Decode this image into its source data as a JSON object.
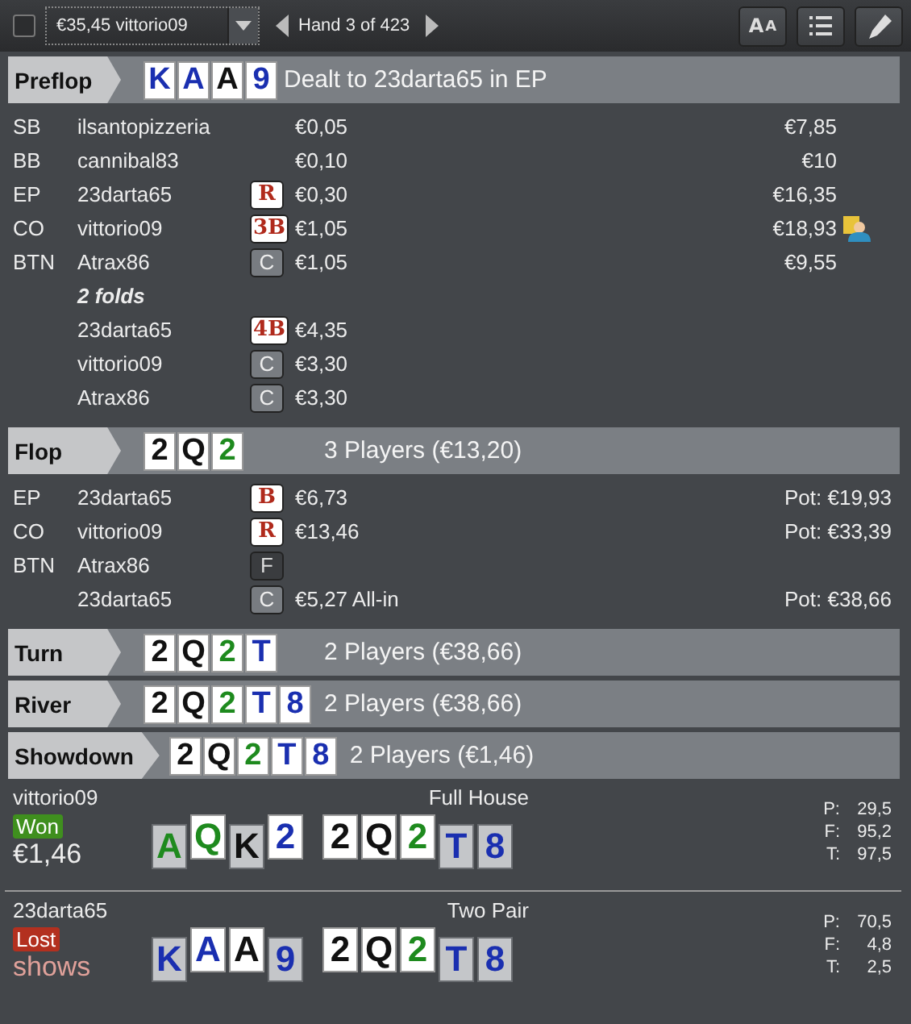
{
  "toolbar": {
    "checked": false,
    "player_select": "€35,45 vittorio09",
    "hand_label": "Hand 3 of 423",
    "font_button": "AA"
  },
  "streets": [
    {
      "kind": "preflop",
      "name": "Preflop",
      "summary": "Dealt to 23darta65 in EP",
      "cards": [
        {
          "rank": "K",
          "color": "#1a2fb0"
        },
        {
          "rank": "A",
          "color": "#1a2fb0"
        },
        {
          "rank": "A",
          "color": "#111111"
        },
        {
          "rank": "9",
          "color": "#1a2fb0"
        }
      ],
      "rows": [
        {
          "kind": "action",
          "position": "SB",
          "player": "ilsantopizzeria",
          "amount": "€0,05",
          "stack": "€7,85",
          "hero": false
        },
        {
          "kind": "action",
          "position": "BB",
          "player": "cannibal83",
          "amount": "€0,10",
          "stack": "€10",
          "hero": false
        },
        {
          "kind": "action",
          "position": "EP",
          "player": "23darta65",
          "badge": {
            "label": "R",
            "kind": "bet"
          },
          "amount": "€0,30",
          "stack": "€16,35",
          "hero": false
        },
        {
          "kind": "action",
          "position": "CO",
          "player": "vittorio09",
          "badge": {
            "label": "3B",
            "kind": "bet"
          },
          "amount": "€1,05",
          "stack": "€18,93",
          "hero": true
        },
        {
          "kind": "action",
          "position": "BTN",
          "player": "Atrax86",
          "badge": {
            "label": "C",
            "kind": "call"
          },
          "amount": "€1,05",
          "stack": "€9,55",
          "hero": false
        },
        {
          "kind": "note",
          "player": "2 folds"
        },
        {
          "kind": "action",
          "player": "23darta65",
          "badge": {
            "label": "4B",
            "kind": "bet"
          },
          "amount": "€4,35"
        },
        {
          "kind": "action",
          "player": "vittorio09",
          "badge": {
            "label": "C",
            "kind": "call"
          },
          "amount": "€3,30"
        },
        {
          "kind": "action",
          "player": "Atrax86",
          "badge": {
            "label": "C",
            "kind": "call"
          },
          "amount": "€3,30"
        }
      ]
    },
    {
      "kind": "street",
      "name": "Flop",
      "summary": "3 Players (€13,20)",
      "cards": [
        {
          "rank": "2",
          "color": "#111111"
        },
        {
          "rank": "Q",
          "color": "#111111"
        },
        {
          "rank": "2",
          "color": "#1e8a1e"
        }
      ],
      "rows": [
        {
          "kind": "action",
          "position": "EP",
          "player": "23darta65",
          "badge": {
            "label": "B",
            "kind": "bet"
          },
          "amount": "€6,73",
          "pot": "Pot: €19,93"
        },
        {
          "kind": "action",
          "position": "CO",
          "player": "vittorio09",
          "badge": {
            "label": "R",
            "kind": "bet"
          },
          "amount": "€13,46",
          "pot": "Pot: €33,39"
        },
        {
          "kind": "action",
          "position": "BTN",
          "player": "Atrax86",
          "badge": {
            "label": "F",
            "kind": "fold"
          }
        },
        {
          "kind": "action",
          "player": "23darta65",
          "badge": {
            "label": "C",
            "kind": "call"
          },
          "amount": "€5,27 All-in",
          "pot": "Pot: €38,66"
        }
      ]
    },
    {
      "kind": "street",
      "name": "Turn",
      "summary": "2 Players (€38,66)",
      "cards": [
        {
          "rank": "2",
          "color": "#111111"
        },
        {
          "rank": "Q",
          "color": "#111111"
        },
        {
          "rank": "2",
          "color": "#1e8a1e"
        },
        {
          "rank": "T",
          "color": "#1a2fb0"
        }
      ]
    },
    {
      "kind": "street",
      "name": "River",
      "summary": "2 Players (€38,66)",
      "cards": [
        {
          "rank": "2",
          "color": "#111111"
        },
        {
          "rank": "Q",
          "color": "#111111"
        },
        {
          "rank": "2",
          "color": "#1e8a1e"
        },
        {
          "rank": "T",
          "color": "#1a2fb0"
        },
        {
          "rank": "8",
          "color": "#1a2fb0"
        }
      ]
    },
    {
      "kind": "showdown",
      "name": "Showdown",
      "summary": "2 Players (€1,46)",
      "cards": [
        {
          "rank": "2",
          "color": "#111111"
        },
        {
          "rank": "Q",
          "color": "#111111"
        },
        {
          "rank": "2",
          "color": "#1e8a1e"
        },
        {
          "rank": "T",
          "color": "#1a2fb0"
        },
        {
          "rank": "8",
          "color": "#1a2fb0"
        }
      ]
    }
  ],
  "showdown": [
    {
      "player": "vittorio09",
      "hand": "Full House",
      "result": {
        "label": "Won",
        "kind": "won"
      },
      "amount": "€1,46",
      "hole_cards": [
        {
          "rank": "A",
          "color": "#1e8a1e",
          "used": false
        },
        {
          "rank": "Q",
          "color": "#1e8a1e",
          "used": true
        },
        {
          "rank": "K",
          "color": "#111111",
          "used": false
        },
        {
          "rank": "2",
          "color": "#1a2fb0",
          "used": true
        }
      ],
      "board": [
        {
          "rank": "2",
          "color": "#111111",
          "used": true
        },
        {
          "rank": "Q",
          "color": "#111111",
          "used": true
        },
        {
          "rank": "2",
          "color": "#1e8a1e",
          "used": true
        },
        {
          "rank": "T",
          "color": "#1a2fb0",
          "used": false
        },
        {
          "rank": "8",
          "color": "#1a2fb0",
          "used": false
        }
      ],
      "stats": [
        {
          "label": "P:",
          "value": "29,5"
        },
        {
          "label": "F:",
          "value": "95,2"
        },
        {
          "label": "T:",
          "value": "97,5"
        }
      ]
    },
    {
      "player": "23darta65",
      "hand": "Two Pair",
      "result": {
        "label": "Lost",
        "kind": "lost"
      },
      "amount": "shows",
      "hole_cards": [
        {
          "rank": "K",
          "color": "#1a2fb0",
          "used": false
        },
        {
          "rank": "A",
          "color": "#1a2fb0",
          "used": true
        },
        {
          "rank": "A",
          "color": "#111111",
          "used": true
        },
        {
          "rank": "9",
          "color": "#1a2fb0",
          "used": false
        }
      ],
      "board": [
        {
          "rank": "2",
          "color": "#111111",
          "used": true
        },
        {
          "rank": "Q",
          "color": "#111111",
          "used": true
        },
        {
          "rank": "2",
          "color": "#1e8a1e",
          "used": true
        },
        {
          "rank": "T",
          "color": "#1a2fb0",
          "used": false
        },
        {
          "rank": "8",
          "color": "#1a2fb0",
          "used": false
        }
      ],
      "stats": [
        {
          "label": "P:",
          "value": "70,5"
        },
        {
          "label": "F:",
          "value": "4,8"
        },
        {
          "label": "T:",
          "value": "2,5"
        }
      ]
    }
  ]
}
